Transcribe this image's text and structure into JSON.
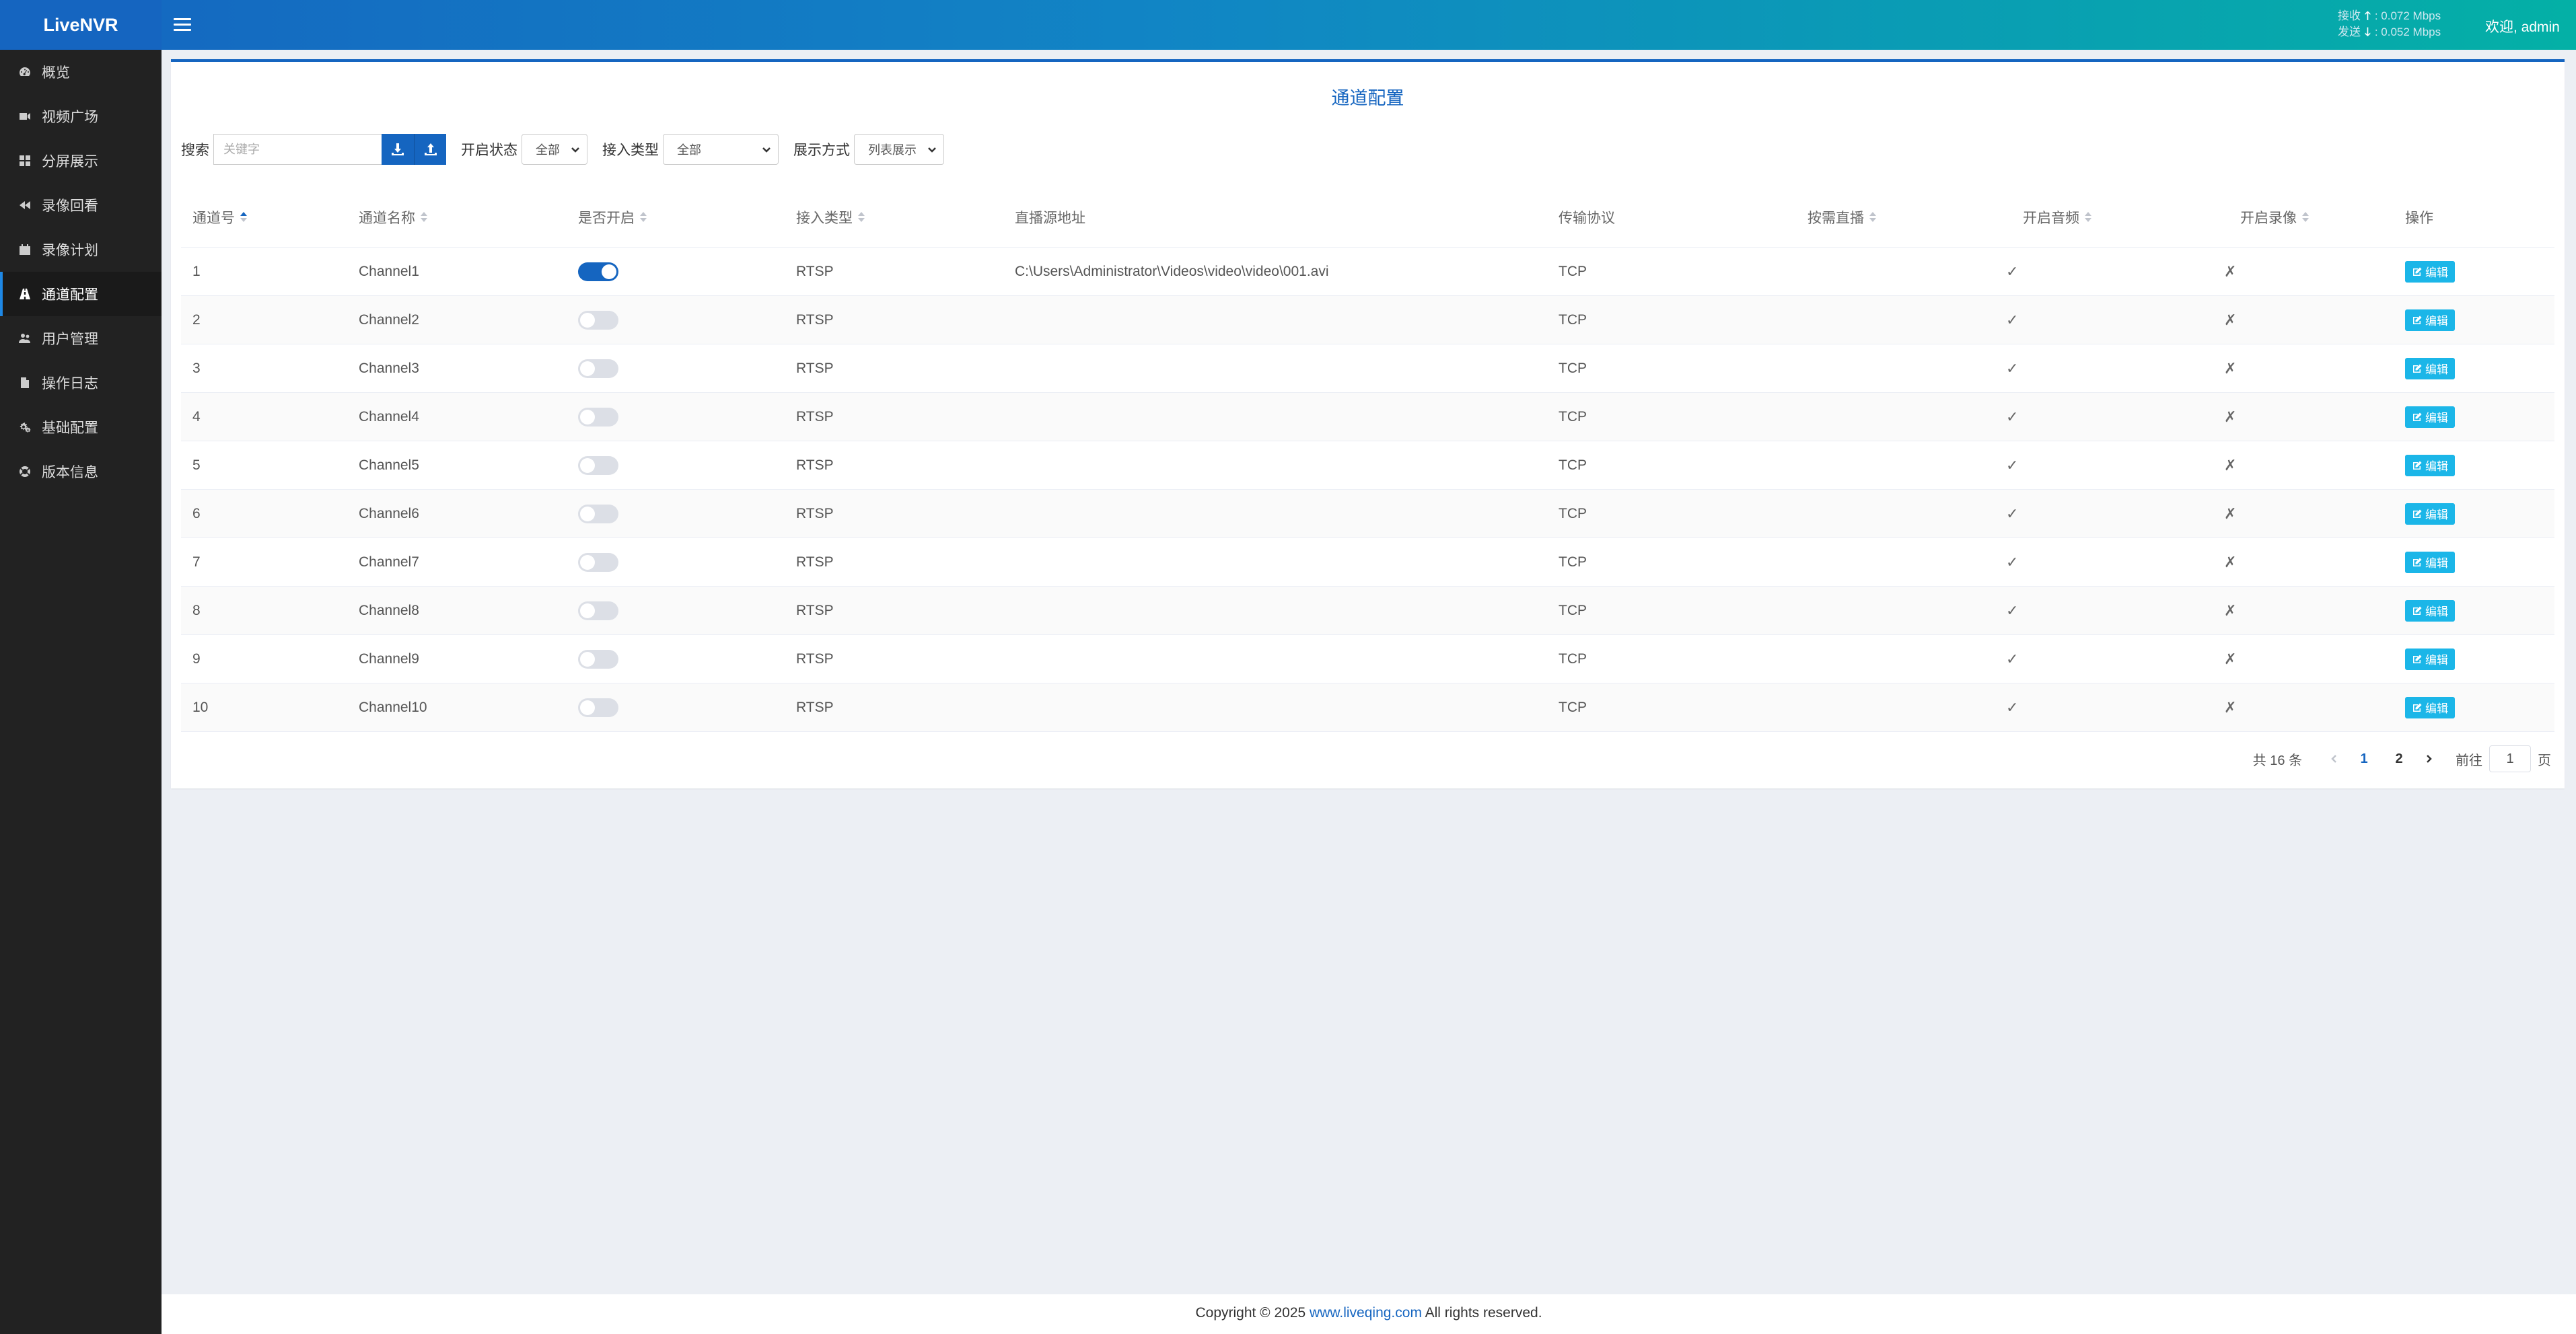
{
  "app": {
    "title": "LiveNVR"
  },
  "header": {
    "recv_label": "接收",
    "send_label": "发送",
    "recv_rate": "0.072 Mbps",
    "send_rate": "0.052 Mbps",
    "welcome": "欢迎, admin"
  },
  "sidebar": {
    "items": [
      {
        "label": "概览",
        "icon": "dashboard-icon"
      },
      {
        "label": "视频广场",
        "icon": "video-icon"
      },
      {
        "label": "分屏展示",
        "icon": "grid-icon"
      },
      {
        "label": "录像回看",
        "icon": "rewind-icon"
      },
      {
        "label": "录像计划",
        "icon": "calendar-icon"
      },
      {
        "label": "通道配置",
        "icon": "road-icon",
        "active": true
      },
      {
        "label": "用户管理",
        "icon": "users-icon"
      },
      {
        "label": "操作日志",
        "icon": "file-icon"
      },
      {
        "label": "基础配置",
        "icon": "cogs-icon"
      },
      {
        "label": "版本信息",
        "icon": "lifebuoy-icon"
      }
    ]
  },
  "panel": {
    "title": "通道配置"
  },
  "toolbar": {
    "search_label": "搜索",
    "search_placeholder": "关键字",
    "status_label": "开启状态",
    "status_value": "全部",
    "type_label": "接入类型",
    "type_value": "全部",
    "display_label": "展示方式",
    "display_value": "列表展示"
  },
  "table": {
    "columns": [
      "通道号",
      "通道名称",
      "是否开启",
      "接入类型",
      "直播源地址",
      "传输协议",
      "按需直播",
      "开启音频",
      "开启录像",
      "操作"
    ],
    "edit_label": "编辑",
    "rows": [
      {
        "id": "1",
        "name": "Channel1",
        "enabled": true,
        "type": "RTSP",
        "url": "C:\\Users\\Administrator\\Videos\\video\\video\\001.avi",
        "protocol": "TCP",
        "on_demand": "✓",
        "audio": "✗",
        "record": "✗"
      },
      {
        "id": "2",
        "name": "Channel2",
        "enabled": false,
        "type": "RTSP",
        "url": "",
        "protocol": "TCP",
        "on_demand": "✓",
        "audio": "✗",
        "record": "✗"
      },
      {
        "id": "3",
        "name": "Channel3",
        "enabled": false,
        "type": "RTSP",
        "url": "",
        "protocol": "TCP",
        "on_demand": "✓",
        "audio": "✗",
        "record": "✗"
      },
      {
        "id": "4",
        "name": "Channel4",
        "enabled": false,
        "type": "RTSP",
        "url": "",
        "protocol": "TCP",
        "on_demand": "✓",
        "audio": "✗",
        "record": "✗"
      },
      {
        "id": "5",
        "name": "Channel5",
        "enabled": false,
        "type": "RTSP",
        "url": "",
        "protocol": "TCP",
        "on_demand": "✓",
        "audio": "✗",
        "record": "✗"
      },
      {
        "id": "6",
        "name": "Channel6",
        "enabled": false,
        "type": "RTSP",
        "url": "",
        "protocol": "TCP",
        "on_demand": "✓",
        "audio": "✗",
        "record": "✗"
      },
      {
        "id": "7",
        "name": "Channel7",
        "enabled": false,
        "type": "RTSP",
        "url": "",
        "protocol": "TCP",
        "on_demand": "✓",
        "audio": "✗",
        "record": "✗"
      },
      {
        "id": "8",
        "name": "Channel8",
        "enabled": false,
        "type": "RTSP",
        "url": "",
        "protocol": "TCP",
        "on_demand": "✓",
        "audio": "✗",
        "record": "✗"
      },
      {
        "id": "9",
        "name": "Channel9",
        "enabled": false,
        "type": "RTSP",
        "url": "",
        "protocol": "TCP",
        "on_demand": "✓",
        "audio": "✗",
        "record": "✗"
      },
      {
        "id": "10",
        "name": "Channel10",
        "enabled": false,
        "type": "RTSP",
        "url": "",
        "protocol": "TCP",
        "on_demand": "✓",
        "audio": "✗",
        "record": "✗"
      }
    ]
  },
  "pagination": {
    "total": "共 16 条",
    "pages": [
      "1",
      "2"
    ],
    "current": "1",
    "goto_label": "前往",
    "goto_value": "1",
    "page_suffix": "页"
  },
  "footer": {
    "prefix": "Copyright © 2025 ",
    "link": "www.liveqing.com",
    "suffix": " All rights reserved."
  },
  "colors": {
    "primary": "#1565c0",
    "accent": "#1bb6e8",
    "sidebar_bg": "#222222",
    "page_bg": "#eceff4"
  }
}
